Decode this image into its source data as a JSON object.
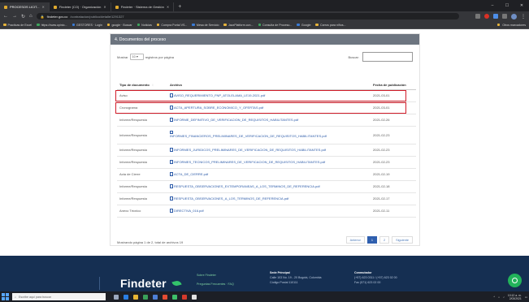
{
  "browser": {
    "tabs": [
      {
        "label": "PROCESOS LICIT...",
        "active": true
      },
      {
        "label": "Findeter (CO) · Organización",
        "active": false
      },
      {
        "label": "Findeter · Sistema de Gestión",
        "active": false
      }
    ],
    "new_tab": "+",
    "url_host": "findeter.gov.co",
    "url_path": "/contratacion/publico/detalle/1291327",
    "bookmarks": [
      "Practicas de Excel",
      "https://www.opinio...",
      "GESTORES · Login",
      "google · Buscar",
      "Noticias",
      "Compra Portal VS...",
      "Mesa de Servicio",
      "JazzPlatform.con...",
      "Consulta de Proceso...",
      "Google",
      "Carros para niños...",
      "Otros marcadores"
    ]
  },
  "panel": {
    "title": "4. Documentos del proceso",
    "show_prefix": "Mostrar",
    "page_length": "10",
    "show_suffix": "registros por página",
    "search_label": "Buscar:",
    "search_value": "",
    "columns": {
      "type": "Tipo de documento",
      "file": "Archivo",
      "date": "Fecha de publicación"
    },
    "rows": [
      {
        "type": "Aviso",
        "file": "AVISO_REQUERIMIENTO_FNP_ATOLELAMA_LE19-2021.pdf",
        "date": "2021-03-01",
        "highlight": true
      },
      {
        "type": "Cronograma",
        "file": "ACTA_APERTURA_SOBRE_ECONOMICO_Y_OFERTAS.pdf",
        "date": "2021-03-01",
        "highlight": true
      },
      {
        "type": "Informe/Respuesta",
        "file": "INFORME_DEFINITIVO_DE_VERIFICACION_DE_REQUISITOS_HABILITANTES.pdf",
        "date": "2021-02-26"
      },
      {
        "type": "Informe/Respuesta",
        "file": "INFORMES_FINANCIEROS_PRELIMINARES_DE_VERIFICACION_DE_REQUISITOS_HABILITANTES.pdf",
        "date": "2021-02-23",
        "tall": true
      },
      {
        "type": "Informe/Respuesta",
        "file": "INFORMES_JURIDICOS_PRELIMINARES_DE_VERIFICACION_DE_REQUISITOS_HABILITANTES.pdf",
        "date": "2021-02-23"
      },
      {
        "type": "Informe/Respuesta",
        "file": "INFORMES_TECNICOS_PRELIMINARES_DE_VERIFICACION_DE_REQUISITOS_HABILITANTES.pdf",
        "date": "2021-02-23"
      },
      {
        "type": "Acta de Cierre",
        "file": "ACTA_DE_CIERRE.pdf",
        "date": "2021-02-19"
      },
      {
        "type": "Informe/Respuesta",
        "file": "RESPUESTA_OBSERVACIONES_EXTEMPORANEAS_A_LOS_TERMINOS_DE_REFERENCIA.pdf",
        "date": "2021-02-18"
      },
      {
        "type": "Informe/Respuesta",
        "file": "RESPUESTA_OBSERVACIONES_A_LOS_TERMINOS_DE_REFERENCIA.pdf",
        "date": "2021-02-17"
      },
      {
        "type": "Anexo Técnico",
        "file": "DIRECTIVA_016.pdf",
        "date": "2021-02-11"
      }
    ],
    "info": "Mostrando página 1 de 2, total de archivos 19",
    "pager": {
      "prev": "Anterior",
      "pages": [
        "1",
        "2"
      ],
      "next": "Siguiente"
    }
  },
  "footer": {
    "logo": "Findeter",
    "links": [
      "Sobre Findeter",
      "Preguntas Frecuentes · FAQ"
    ],
    "hq_title": "Sede Principal",
    "hq_lines": [
      "Calle 103 No. 19 - 20 Bogotá, Colombia",
      "Código Postal 110111"
    ],
    "switch_title": "Conmutador",
    "switch_lines": [
      "(+57) 623 0311 / (+57) 623 02 00",
      "Fax (571) 623 02 00"
    ]
  },
  "taskbar": {
    "search_placeholder": "Escribe aquí para buscar",
    "time": "10:12 a. m.",
    "date": "2/03/2021"
  },
  "colors": {
    "highlight": "#d21d2a",
    "footer": "#152f52",
    "header": "#6d7580",
    "link": "#2b5aa8"
  }
}
